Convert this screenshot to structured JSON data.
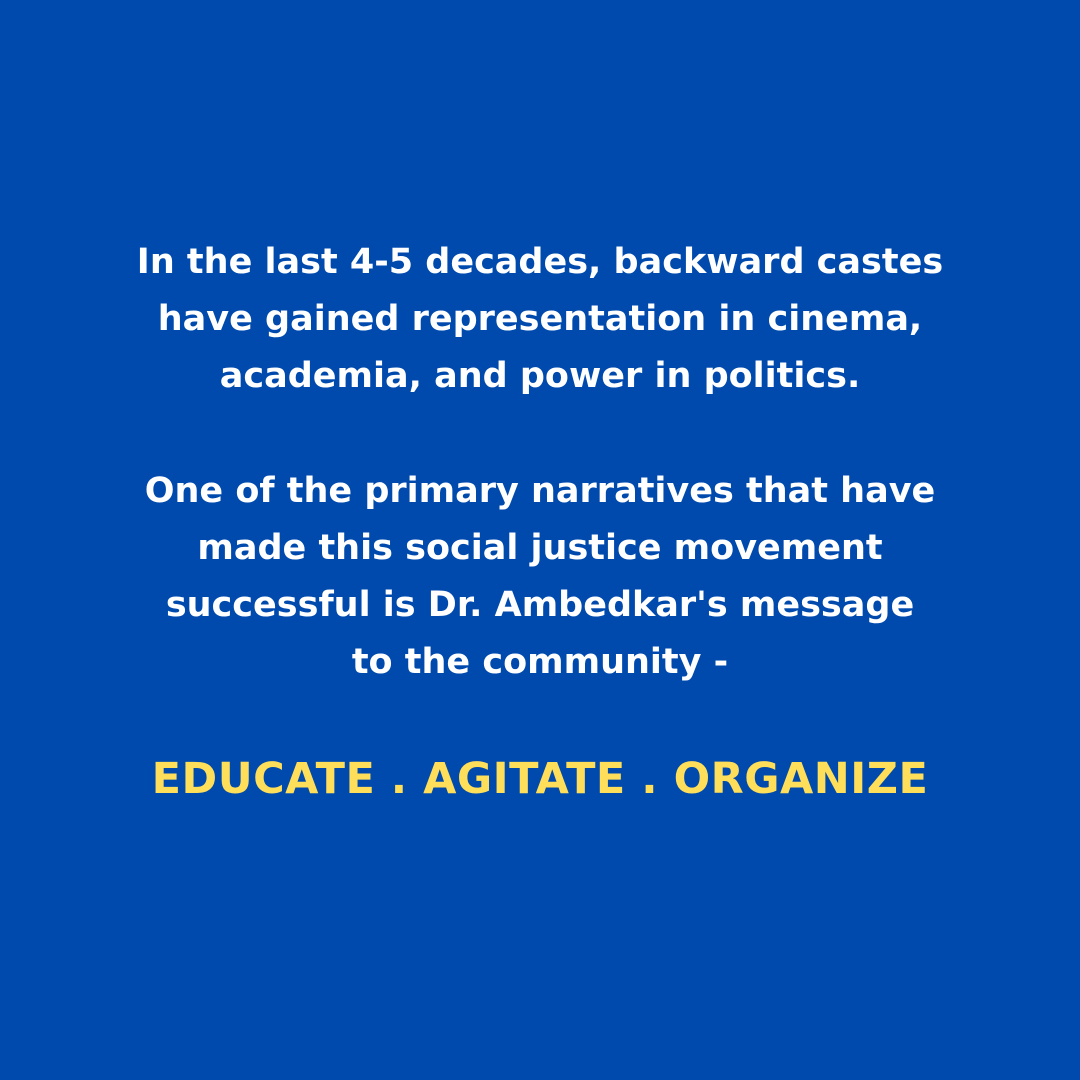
{
  "colors": {
    "background": "#004aad",
    "body_text": "#ffffff",
    "slogan_text": "#ffde59"
  },
  "paragraph_1": {
    "lines": [
      "In the last 4-5 decades, backward castes",
      "have gained representation in cinema,",
      "academia, and power in politics."
    ]
  },
  "paragraph_2": {
    "lines": [
      "One of the primary narratives that have",
      "made this social justice movement",
      "successful is Dr. Ambedkar's message",
      "to the community -"
    ]
  },
  "slogan": {
    "text": "EDUCATE . AGITATE . ORGANIZE"
  }
}
